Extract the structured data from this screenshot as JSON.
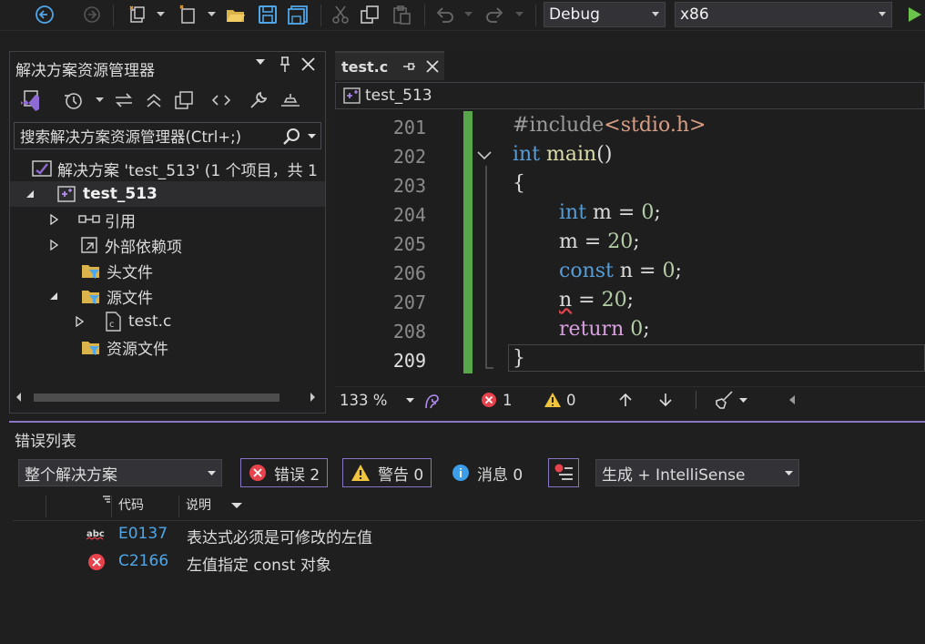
{
  "toolbar": {
    "config": "Debug",
    "platform": "x86"
  },
  "solution_explorer": {
    "title": "解决方案资源管理器",
    "search_placeholder": "搜索解决方案资源管理器(Ctrl+;)",
    "solution_label": "解决方案 'test_513' (1 个项目，共 1",
    "project": "test_513",
    "items": [
      {
        "label": "引用"
      },
      {
        "label": "外部依赖项"
      },
      {
        "label": "头文件"
      },
      {
        "label": "源文件"
      },
      {
        "label": "test.c"
      },
      {
        "label": "资源文件"
      }
    ]
  },
  "editor": {
    "tab_label": "test.c",
    "nav_scope": "test_513",
    "line_numbers": [
      "201",
      "202",
      "203",
      "204",
      "205",
      "206",
      "207",
      "208",
      "209"
    ],
    "zoom": "133 %",
    "error_count": "1",
    "warning_count": "0"
  },
  "error_list": {
    "title": "错误列表",
    "scope": "整个解决方案",
    "errors_btn": "错误 2",
    "warnings_btn": "警告 0",
    "messages_btn": "消息 0",
    "source": "生成 + IntelliSense",
    "col_code": "代码",
    "col_desc": "说明",
    "rows": [
      {
        "code": "E0137",
        "desc": "表达式必须是可修改的左值"
      },
      {
        "code": "C2166",
        "desc": "左值指定 const 对象"
      }
    ]
  },
  "colors": {
    "accent": "#8a74c4",
    "error": "#e8434d",
    "warning": "#f0c43c",
    "info": "#3c9de8",
    "keyword": "#569cd6"
  }
}
